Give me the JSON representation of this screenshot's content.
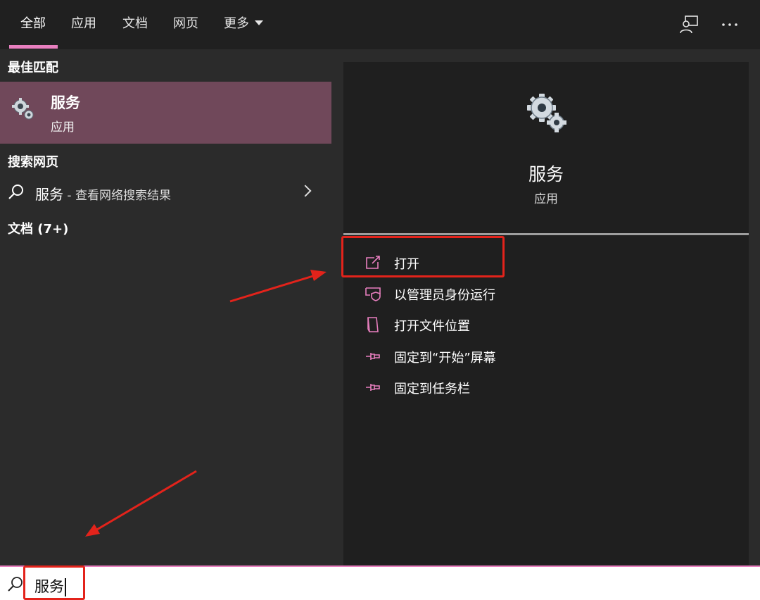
{
  "tabs": [
    {
      "label": "全部",
      "active": true
    },
    {
      "label": "应用"
    },
    {
      "label": "文档"
    },
    {
      "label": "网页"
    },
    {
      "label": "更多"
    }
  ],
  "top_icons": [
    "feedback-icon",
    "more-options-icon"
  ],
  "left": {
    "best_match_header": "最佳匹配",
    "best_match": {
      "title": "服务",
      "subtitle": "应用",
      "icon": "gears-icon"
    },
    "web_header": "搜索网页",
    "web_item": {
      "query": "服务",
      "suffix": " - 查看网络搜索结果",
      "icon": "search-icon"
    },
    "docs_header": "文档 (7+)"
  },
  "right": {
    "app_title": "服务",
    "app_subtitle": "应用",
    "actions": [
      {
        "label": "打开",
        "icon": "open-icon"
      },
      {
        "label": "以管理员身份运行",
        "icon": "admin-shield-icon"
      },
      {
        "label": "打开文件位置",
        "icon": "file-location-icon"
      },
      {
        "label": "固定到“开始”屏幕",
        "icon": "pin-icon"
      },
      {
        "label": "固定到任务栏",
        "icon": "pin-icon"
      }
    ]
  },
  "search": {
    "value": "服务",
    "icon": "search-icon"
  },
  "colors": {
    "accent": "#e87fbf",
    "best_match_bg": "#70485a",
    "annotation_red": "#e3231b",
    "panel_bg": "#2b2b2b",
    "detail_bg": "#1f1f1f"
  }
}
